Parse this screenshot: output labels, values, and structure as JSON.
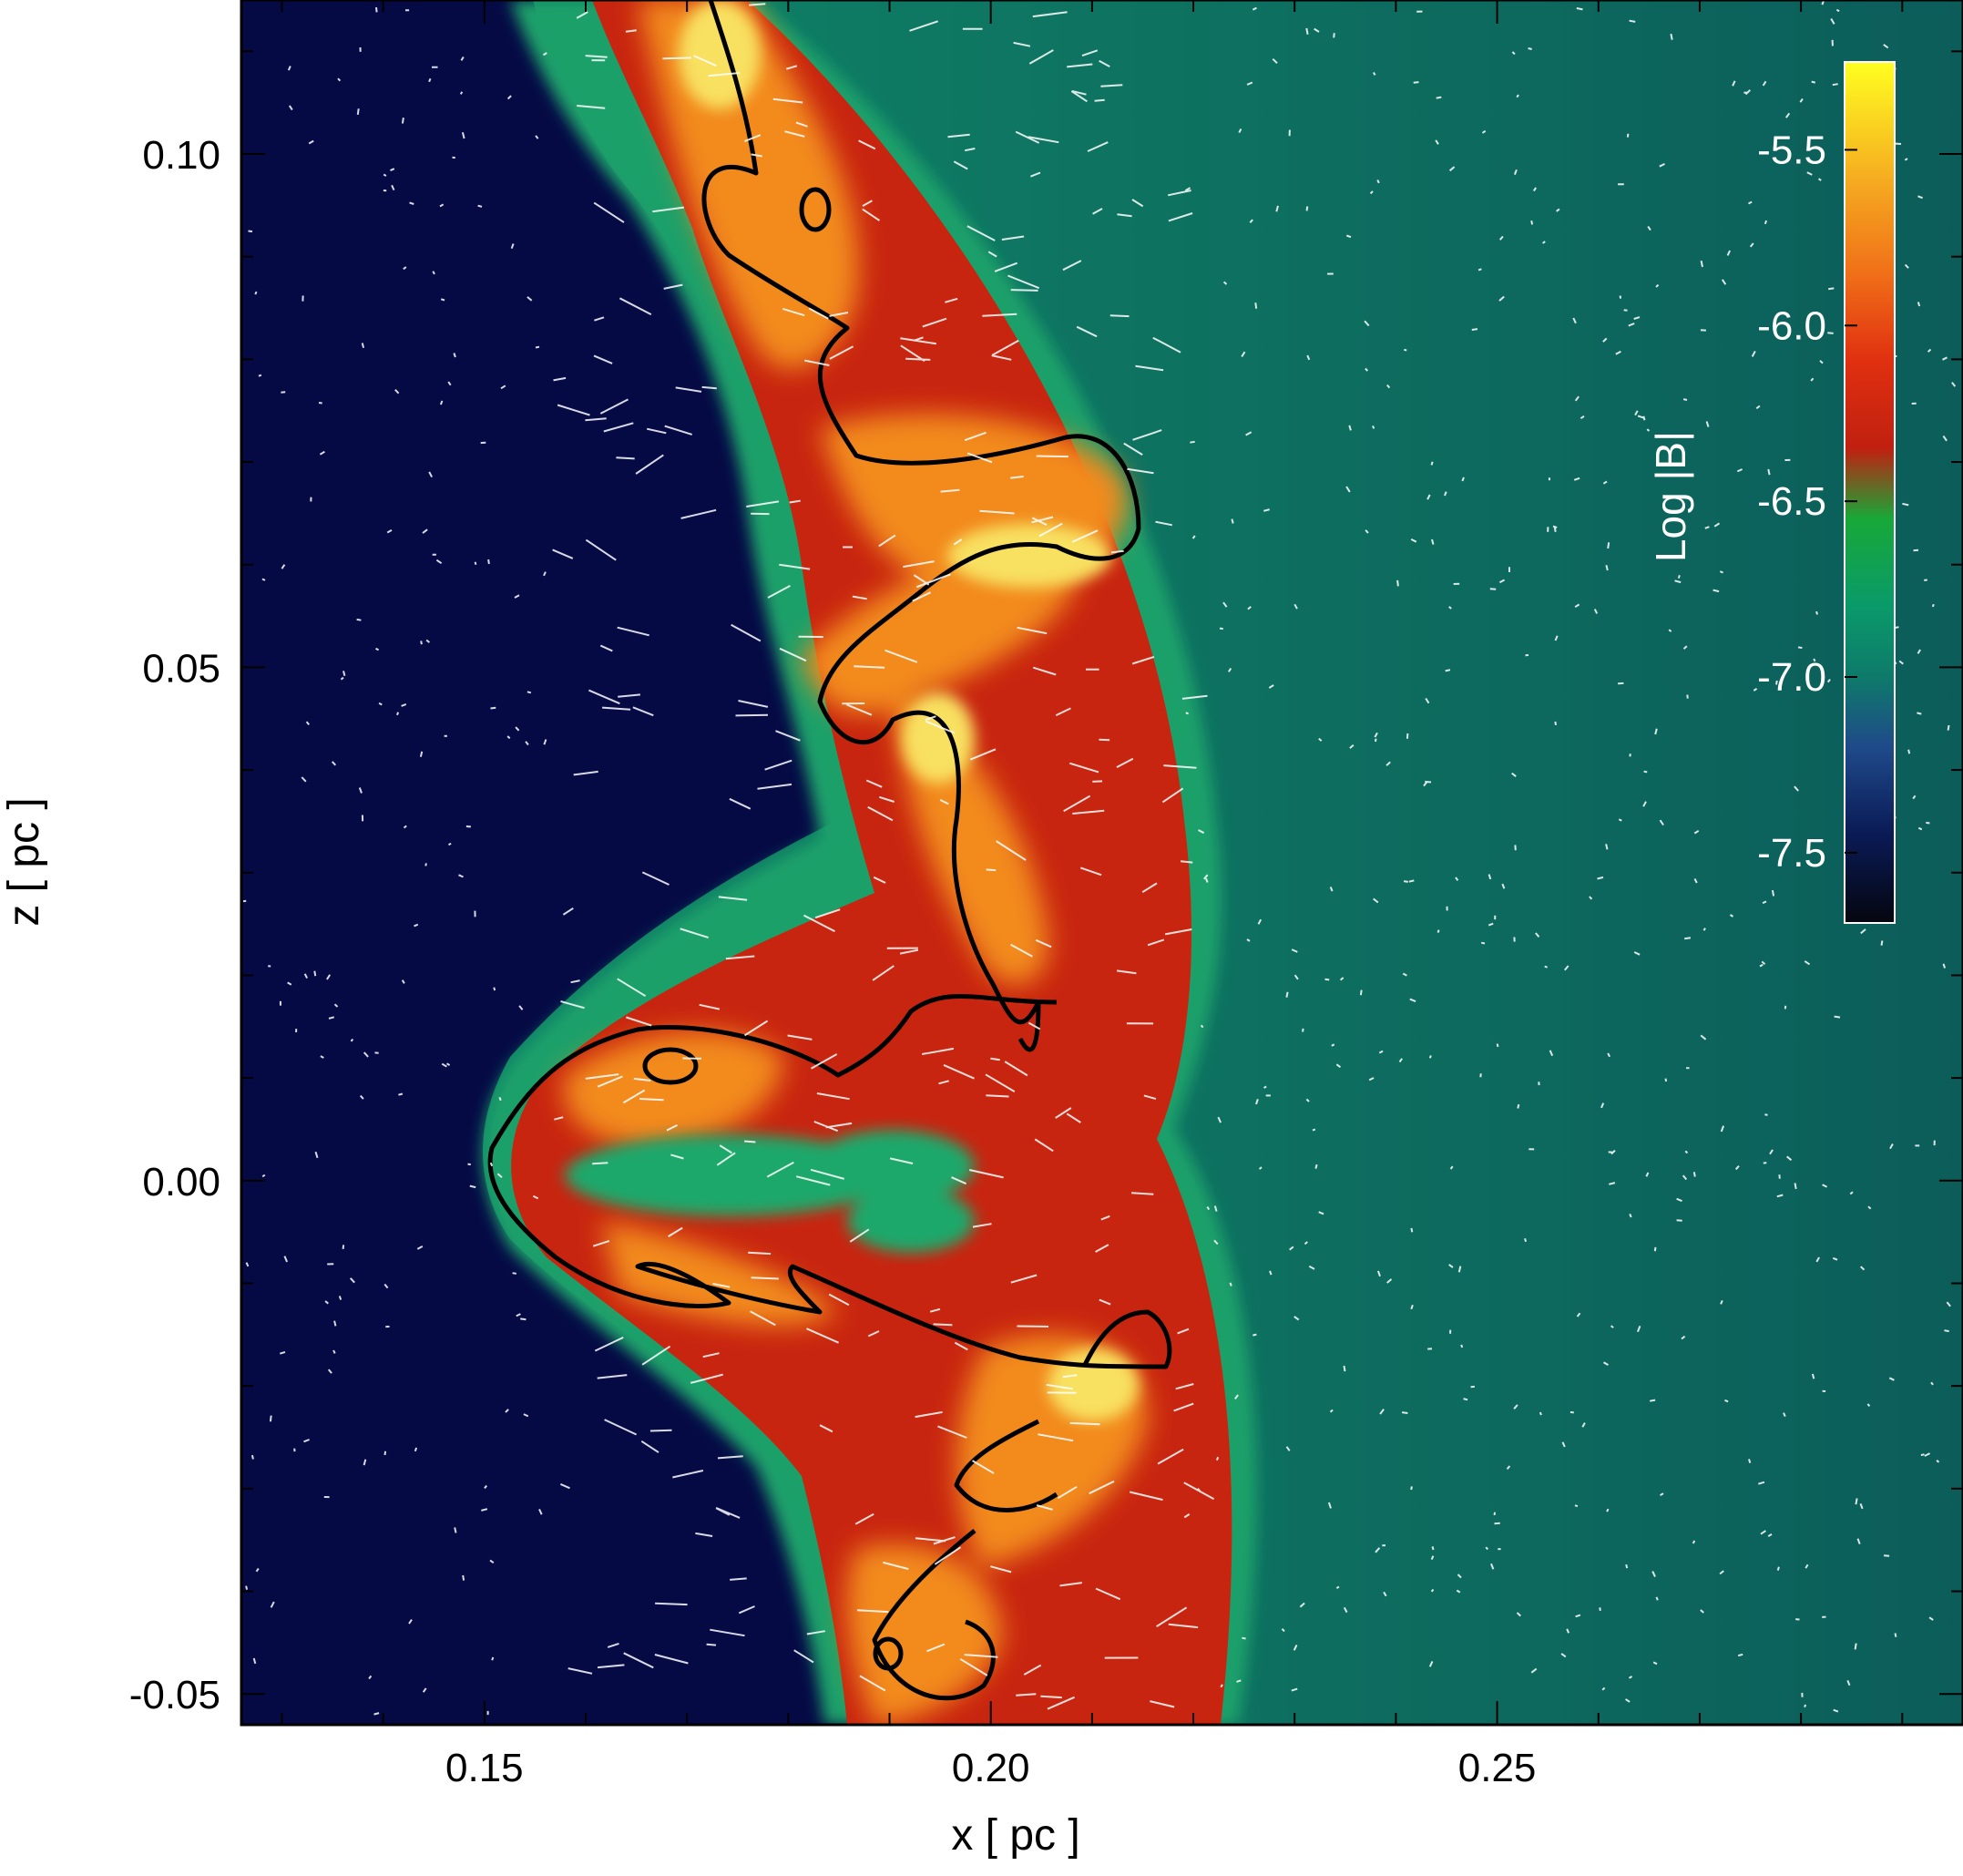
{
  "chart_data": {
    "type": "heatmap",
    "title": "",
    "xlabel": "x [ pc ]",
    "ylabel": "z [ pc ]",
    "xlim": [
      0.126,
      0.296
    ],
    "ylim": [
      -0.053,
      0.115
    ],
    "x_ticks": [
      {
        "value": 0.15,
        "label": "0.15"
      },
      {
        "value": 0.2,
        "label": "0.20"
      },
      {
        "value": 0.25,
        "label": "0.25"
      }
    ],
    "y_ticks": [
      {
        "value": 0.1,
        "label": "0.10"
      },
      {
        "value": 0.05,
        "label": "0.05"
      },
      {
        "value": 0.0,
        "label": "0.00"
      },
      {
        "value": -0.05,
        "label": "-0.05"
      }
    ],
    "x_minor_step": 0.01,
    "y_minor_step": 0.01,
    "colorbar": {
      "title": "Log |B|",
      "range": [
        -7.7,
        -5.25
      ],
      "ticks": [
        {
          "value": -5.5,
          "label": "-5.5"
        },
        {
          "value": -6.0,
          "label": "-6.0"
        },
        {
          "value": -6.5,
          "label": "-6.5"
        },
        {
          "value": -7.0,
          "label": "-7.0"
        },
        {
          "value": -7.5,
          "label": "-7.5"
        }
      ],
      "colormap": [
        {
          "value": -7.7,
          "color": "#05060f"
        },
        {
          "value": -7.45,
          "color": "#0a1a55"
        },
        {
          "value": -7.2,
          "color": "#1f4a8a"
        },
        {
          "value": -7.0,
          "color": "#0e7a6a"
        },
        {
          "value": -6.8,
          "color": "#0a9a6a"
        },
        {
          "value": -6.55,
          "color": "#18a838"
        },
        {
          "value": -6.35,
          "color": "#c02010"
        },
        {
          "value": -6.1,
          "color": "#e03010"
        },
        {
          "value": -5.85,
          "color": "#f07018"
        },
        {
          "value": -5.6,
          "color": "#f5a820"
        },
        {
          "value": -5.25,
          "color": "#ffff20"
        }
      ]
    },
    "regions": {
      "background_left": "#050a45",
      "background_right": "#0e6e60",
      "shell_outer": "#1aa06a",
      "shell": "#c82510",
      "hot": "#f59a20",
      "peak": "#f8e060",
      "contour": "#000000",
      "field_lines": "#ffffff"
    }
  }
}
